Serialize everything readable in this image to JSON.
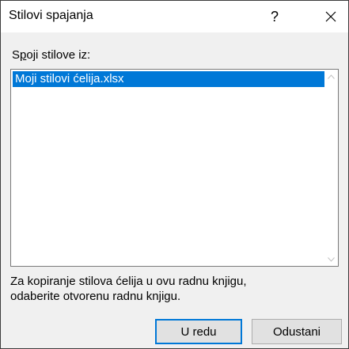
{
  "dialog": {
    "title": "Stilovi spajanja",
    "help_label": "?",
    "close_icon": "close-icon",
    "help_icon": "help-icon"
  },
  "source": {
    "label_prefix": "S",
    "label_accesskey": "p",
    "label_rest": "oji stilove iz:",
    "items": [
      "Moji stilovi ćelija.xlsx"
    ],
    "selected_index": 0
  },
  "info": {
    "line1": "Za kopiranje stilova ćelija u ovu radnu knjigu,",
    "line2": "odaberite otvorenu radnu knjigu."
  },
  "buttons": {
    "ok_label": "U redu",
    "cancel_label": "Odustani"
  },
  "colors": {
    "selection": "#0078d7",
    "dialog_bg": "#f0f0f0"
  }
}
